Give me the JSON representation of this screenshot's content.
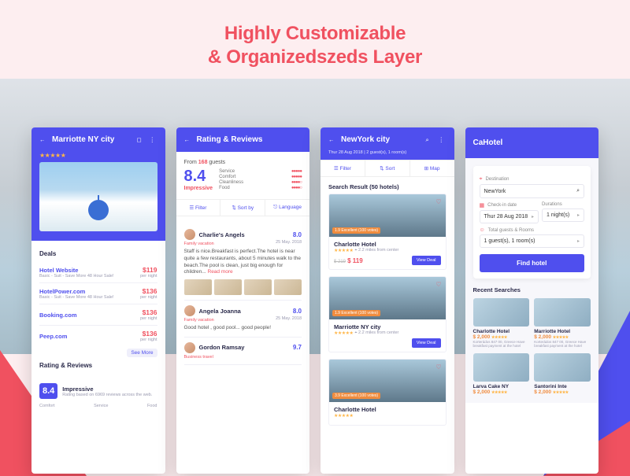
{
  "headline_l1": "Highly Customizable",
  "headline_l2": "& Organizedszeds Layer",
  "screen1": {
    "title": "Marriotte NY city",
    "stars": "★★★★★",
    "deals_heading": "Deals",
    "deals": [
      {
        "name": "Hotel Website",
        "sub": "Basic - Suit - Save More 48 Hour Sale!",
        "price": "$119",
        "per": "per night"
      },
      {
        "name": "HotelPower.com",
        "sub": "Basic - Suit - Save More 48 Hour Sale!",
        "price": "$136",
        "per": "per night"
      },
      {
        "name": "Booking.com",
        "sub": "",
        "price": "$136",
        "per": "per night"
      },
      {
        "name": "Peep.com",
        "sub": "",
        "price": "$136",
        "per": "per night"
      }
    ],
    "see_more": "See More",
    "rr_heading": "Rating & Reviews",
    "rr_score": "8.4",
    "rr_label": "Impressive",
    "rr_sub": "Rating based on 6969 reviews across the web.",
    "rr_cats": [
      "Comfort",
      "Service",
      "Food"
    ]
  },
  "screen2": {
    "title": "Rating & Reviews",
    "from_prefix": "From ",
    "from_count": "168",
    "from_suffix": " guests",
    "score": "8.4",
    "impressive": "Impressive",
    "cats": [
      {
        "k": "Service",
        "v": "●●●●●"
      },
      {
        "k": "Comfort",
        "v": "●●●●●"
      },
      {
        "k": "Cleanliness",
        "v": "●●●●○"
      },
      {
        "k": "Food",
        "v": "●●●●○"
      }
    ],
    "toolbar": {
      "filter": "Filter",
      "sort": "Sort by",
      "lang": "Language"
    },
    "reviews": [
      {
        "name": "Charlie's Angels",
        "score": "8.0",
        "tag": "Family vacation",
        "date": "25 May. 2018",
        "text": "Staff is nice.Breakfast is perfect.The hotel is near quite a few restaurants, about 5 minutes walk to the beach.The pool is clean, just big enough for children... ",
        "more": "Read more",
        "thumbs": true
      },
      {
        "name": "Angela Joanna",
        "score": "8.0",
        "tag": "Family vacation",
        "date": "25 May. 2018",
        "text": "Good hotel , good pool... good people!",
        "thumbs": false
      },
      {
        "name": "Gordon Ramsay",
        "score": "9.7",
        "tag": "Business travel",
        "date": "",
        "text": "",
        "thumbs": false
      }
    ]
  },
  "screen3": {
    "title": "NewYork city",
    "sub": "Thur 28 Aug 2018 | 2 guest(s), 1 room(s)",
    "toolbar": {
      "filter": "Filter",
      "sort": "Sort",
      "map": "Map"
    },
    "results_heading": "Search Result (50 hotels)",
    "cards": [
      {
        "badge": "1.9 Excellent (100 votes)",
        "name": "Charlotte Hotel",
        "dist": "2.2 miles from center",
        "strike": "$ 219",
        "price": "$ 119",
        "view": "View Deal"
      },
      {
        "badge": "1.9 Excellent (100 votes)",
        "name": "Marriotte NY city",
        "dist": "2.2 miles from center",
        "strike": "",
        "price": "",
        "view": "View Deal"
      },
      {
        "badge": "3.9 Excellent (100 votes)",
        "name": "Charlotte Hotel",
        "dist": "",
        "strike": "",
        "price": "",
        "view": ""
      }
    ]
  },
  "screen4": {
    "brand": "CaHotel",
    "form": {
      "dest_label": "Destination",
      "dest_value": "NewYork",
      "checkin_label": "Check-in date",
      "checkin_value": "Thur 28 Aug 2018",
      "dur_label": "Durations",
      "dur_value": "1 night(s)",
      "guests_label": "Total guests & Rooms",
      "guests_value": "1 guest(s), 1 room(s)",
      "button": "Find hotel"
    },
    "recent_heading": "Recent Searches",
    "recent": [
      {
        "name": "Charlotte Hotel",
        "price": "$ 2,000",
        "desc": "Korterádos 847 00, Greece Have breakfast payment at the hotel"
      },
      {
        "name": "Marriotte Hotel",
        "price": "$ 2,000",
        "desc": "Korterádos 847 00, Greece Have breakfast payment at the hotel"
      },
      {
        "name": "Larva Cake NY",
        "price": "$ 2,000",
        "desc": ""
      },
      {
        "name": "Santorini Inte",
        "price": "$ 2,000",
        "desc": ""
      }
    ]
  }
}
